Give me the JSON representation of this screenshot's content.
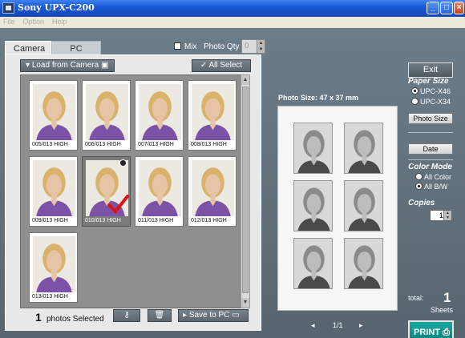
{
  "window": {
    "title": "Sony UPX-C200"
  },
  "menu": [
    "File",
    "Option",
    "Help"
  ],
  "tabs": {
    "camera": "Camera",
    "pc": "PC"
  },
  "options": {
    "mix_label": "Mix",
    "photo_qty_label": "Photo Qty",
    "photo_qty_value": "0"
  },
  "toolbar": {
    "load_label": "Load from Camera",
    "all_select_label": "All Select"
  },
  "thumbnails": [
    {
      "caption": "005/013 HIGH",
      "selected": false
    },
    {
      "caption": "006/013 HIGH",
      "selected": false
    },
    {
      "caption": "007/013 HIGH",
      "selected": false
    },
    {
      "caption": "008/013 HIGH",
      "selected": false
    },
    {
      "caption": "009/013 HIGH",
      "selected": false
    },
    {
      "caption": "010/013 HIGH",
      "selected": true
    },
    {
      "caption": "011/013 HIGH",
      "selected": false
    },
    {
      "caption": "012/013 HIGH",
      "selected": false
    },
    {
      "caption": "013/013 HIGH",
      "selected": false
    }
  ],
  "status": {
    "selected_count": "1",
    "selected_label": "photos Selected"
  },
  "actions": {
    "save_label": "Save to PC"
  },
  "preview": {
    "photo_size": "Photo Size: 47 x 37 mm",
    "page": "1/1"
  },
  "right": {
    "exit_label": "Exit",
    "paper_size_label": "Paper Size",
    "paper_options": [
      "UPC-X46",
      "UPC-X34"
    ],
    "paper_selected": 0,
    "photo_size_btn": "Photo Size",
    "date_btn": "Date",
    "color_mode_label": "Color Mode",
    "color_options": [
      "All Color",
      "All B/W"
    ],
    "color_selected": 1,
    "copies_label": "Copies",
    "copies_value": "1",
    "total_label": "total:",
    "total_value": "1",
    "sheets_label": "Sheets",
    "print_label": "PRINT"
  },
  "colors": {
    "panel_bg": "#6c7d8a",
    "print_accent": "#18a89e",
    "check_red": "#d11"
  }
}
